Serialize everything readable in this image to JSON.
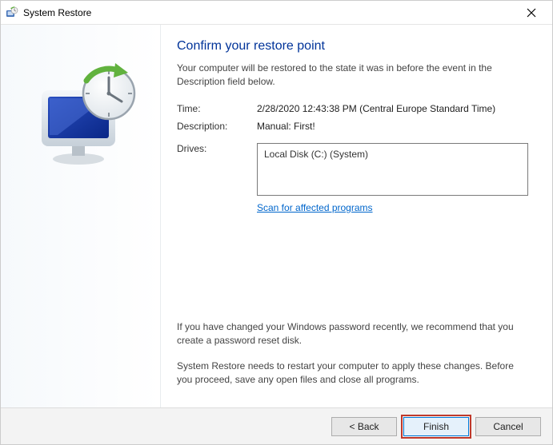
{
  "window": {
    "title": "System Restore"
  },
  "heading": "Confirm your restore point",
  "subtext": "Your computer will be restored to the state it was in before the event in the Description field below.",
  "fields": {
    "time_label": "Time:",
    "time_value": "2/28/2020 12:43:38 PM (Central Europe Standard Time)",
    "description_label": "Description:",
    "description_value": "Manual: First!",
    "drives_label": "Drives:",
    "drives_value": "Local Disk (C:) (System)"
  },
  "scan_link": "Scan for affected programs",
  "note_password": "If you have changed your Windows password recently, we recommend that you create a password reset disk.",
  "note_restart": "System Restore needs to restart your computer to apply these changes. Before you proceed, save any open files and close all programs.",
  "buttons": {
    "back": "< Back",
    "finish": "Finish",
    "cancel": "Cancel"
  }
}
